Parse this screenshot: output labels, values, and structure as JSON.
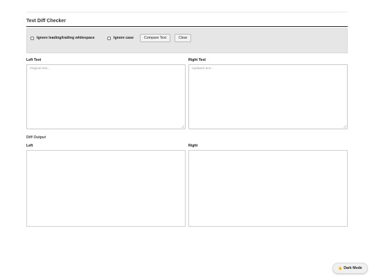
{
  "header": {
    "title": "Text Diff Checker"
  },
  "toolbar": {
    "ignore_whitespace_label": "Ignore leading/trailing whitespace",
    "ignore_case_label": "Ignore case",
    "compare_label": "Compare Text",
    "clear_label": "Clear"
  },
  "inputs": {
    "left_label": "Left Text",
    "left_placeholder": "Original text...",
    "right_label": "Right Text",
    "right_placeholder": "Updated text..."
  },
  "output": {
    "section_title": "Diff Output",
    "left_label": "Left",
    "right_label": "Right"
  },
  "theme_toggle": {
    "label": "Dark Mode",
    "icon": "moon-icon"
  }
}
